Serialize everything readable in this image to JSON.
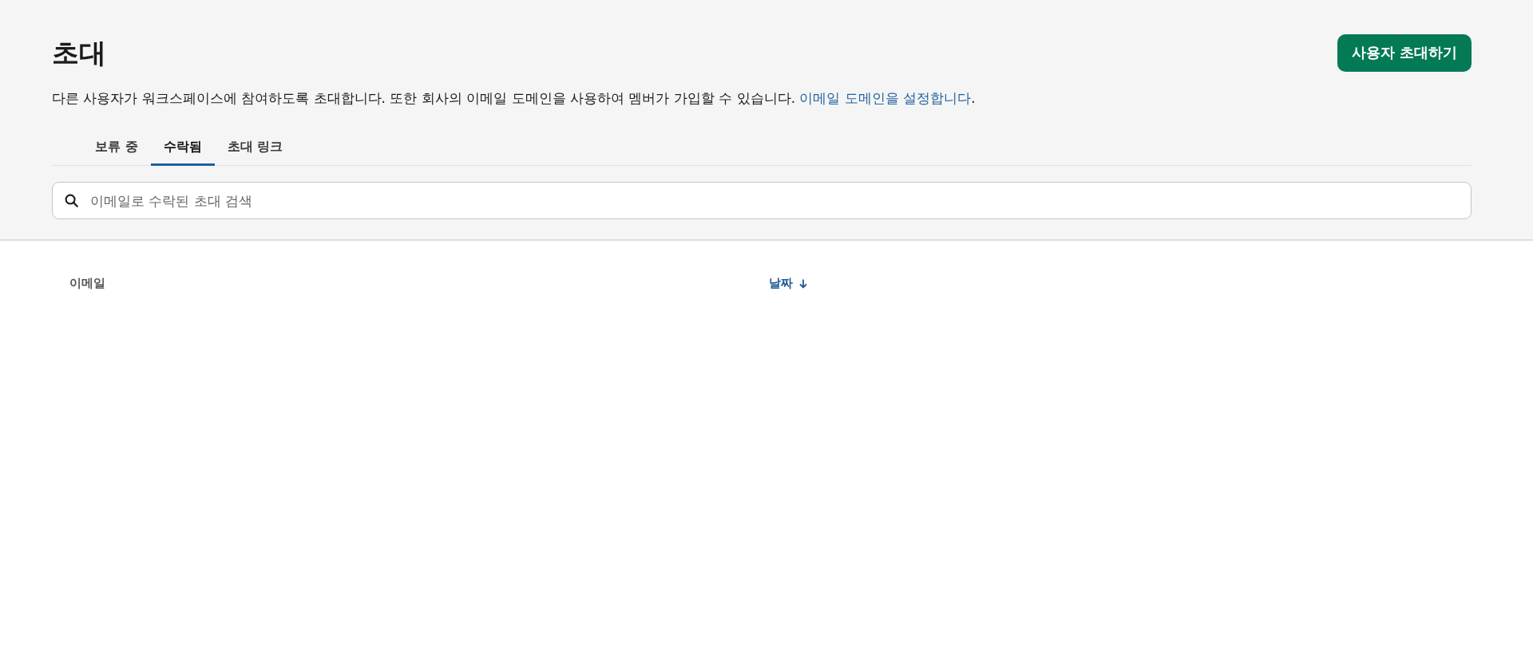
{
  "header": {
    "title": "초대",
    "invite_button": "사용자 초대하기",
    "description": {
      "text": "다른 사용자가 워크스페이스에 참여하도록 초대합니다. 또한 회사의 이메일 도메인을 사용하여 멤버가 가입할 수 있습니다.",
      "link": "이메일 도메인을 설정합니다",
      "end": "."
    }
  },
  "tabs": [
    {
      "label": "보류 중",
      "selected": false
    },
    {
      "label": "수락됨",
      "selected": true
    },
    {
      "label": "초대 링크",
      "selected": false
    }
  ],
  "search": {
    "placeholder": "이메일로 수락된 초대 검색"
  },
  "table": {
    "columns": [
      {
        "label": "이메일",
        "sorted": false
      },
      {
        "label": "날짜",
        "sorted": true
      }
    ]
  }
}
